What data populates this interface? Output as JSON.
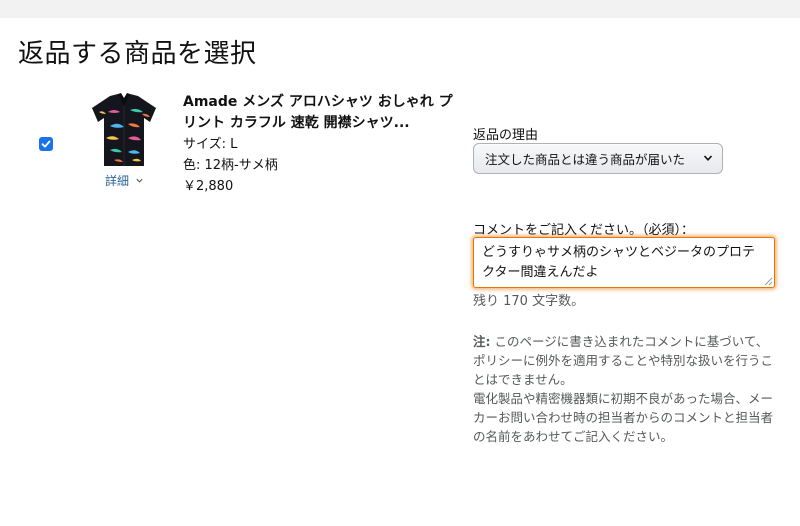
{
  "page": {
    "title": "返品する商品を選択"
  },
  "product": {
    "selected": true,
    "title": "Amade メンズ アロハシャツ おしゃれ プリント カラフル 速乾 開襟シャツ...",
    "size": "サイズ: L",
    "color": "色: 12柄-サメ柄",
    "price": "￥2,880",
    "details_label": "詳細",
    "image_icon": "aloha-shirt-image"
  },
  "reason": {
    "label": "返品の理由",
    "selected_option": "注文した商品とは違う商品が届いた"
  },
  "comment": {
    "label": "コメントをご記入ください。（必須）：",
    "value": "どうすりゃサメ柄のシャツとベジータのプロテクター間違えんだよ",
    "remaining": "残り 170 文字数。"
  },
  "note": {
    "prefix": "注:",
    "text1": " このページに書き込まれたコメントに基づいて、ポリシーに例外を適用することや特別な扱いを行うことはできません。",
    "text2": "電化製品や精密機器類に初期不良があった場合、メーカーお問い合わせ時の担当者からのコメントと担当者の名前をあわせてご記入ください。"
  },
  "colors": {
    "accent_orange": "#e77600",
    "link_blue": "#2a6496",
    "checkbox_blue": "#1a73e8"
  }
}
